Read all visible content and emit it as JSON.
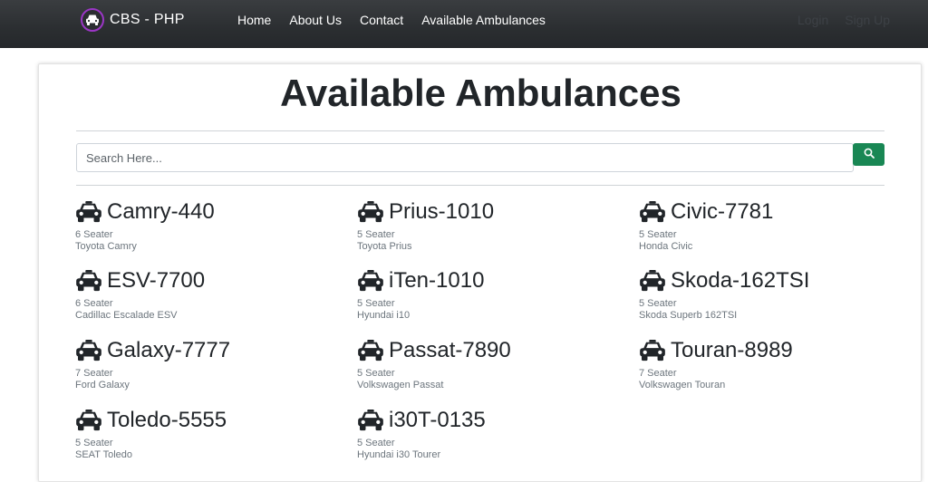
{
  "navbar": {
    "brand": "CBS - PHP",
    "links": [
      "Home",
      "About Us",
      "Contact",
      "Available Ambulances"
    ],
    "login": "Login",
    "signup": "Sign Up"
  },
  "main": {
    "title": "Available Ambulances",
    "search": {
      "placeholder": "Search Here...",
      "value": ""
    }
  },
  "vehicles": [
    {
      "name": "Camry-440",
      "seats": "6 Seater",
      "model": "Toyota Camry"
    },
    {
      "name": "Prius-1010",
      "seats": "5 Seater",
      "model": "Toyota Prius"
    },
    {
      "name": "Civic-7781",
      "seats": "5 Seater",
      "model": "Honda Civic"
    },
    {
      "name": "ESV-7700",
      "seats": "6 Seater",
      "model": "Cadillac Escalade ESV"
    },
    {
      "name": "iTen-1010",
      "seats": "5 Seater",
      "model": "Hyundai i10"
    },
    {
      "name": "Skoda-162TSI",
      "seats": "5 Seater",
      "model": "Skoda Superb 162TSI"
    },
    {
      "name": "Galaxy-7777",
      "seats": "7 Seater",
      "model": "Ford Galaxy"
    },
    {
      "name": "Passat-7890",
      "seats": "5 Seater",
      "model": "Volkswagen Passat"
    },
    {
      "name": "Touran-8989",
      "seats": "7 Seater",
      "model": "Volkswagen Touran"
    },
    {
      "name": "Toledo-5555",
      "seats": "5 Seater",
      "model": "SEAT Toledo"
    },
    {
      "name": "i30T-0135",
      "seats": "5 Seater",
      "model": "Hyundai i30 Tourer"
    }
  ],
  "icons": {
    "brand": "car-icon",
    "vehicle": "taxi-icon",
    "search": "search-icon"
  },
  "colors": {
    "navbar": "#2b2e31",
    "accent": "#198754",
    "brand_ring": "#9b36c6"
  }
}
